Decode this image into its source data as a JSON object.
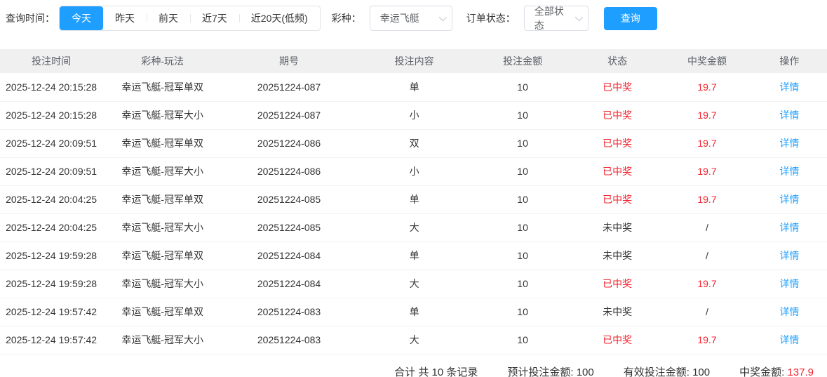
{
  "colors": {
    "accent": "#1e9fff",
    "win_red": "#f5222d"
  },
  "toolbar": {
    "time_label": "查询时间：",
    "time_options": [
      {
        "label": "今天",
        "active": true
      },
      {
        "label": "昨天",
        "active": false
      },
      {
        "label": "前天",
        "active": false
      },
      {
        "label": "近7天",
        "active": false
      },
      {
        "label": "近20天(低频)",
        "active": false
      }
    ],
    "lottery_label": "彩种：",
    "lottery_value": "幸运飞艇",
    "status_label": "订单状态：",
    "status_value": "全部状态",
    "query_button": "查询"
  },
  "table": {
    "headers": [
      "投注时间",
      "彩种-玩法",
      "期号",
      "投注内容",
      "投注金额",
      "状态",
      "中奖金额",
      "操作"
    ],
    "rows": [
      {
        "time": "2025-12-24 20:15:28",
        "game": "幸运飞艇-冠军单双",
        "issue": "20251224-087",
        "content": "单",
        "amount": "10",
        "status": "已中奖",
        "won": true,
        "prize": "19.7",
        "action": "详情"
      },
      {
        "time": "2025-12-24 20:15:28",
        "game": "幸运飞艇-冠军大小",
        "issue": "20251224-087",
        "content": "小",
        "amount": "10",
        "status": "已中奖",
        "won": true,
        "prize": "19.7",
        "action": "详情"
      },
      {
        "time": "2025-12-24 20:09:51",
        "game": "幸运飞艇-冠军单双",
        "issue": "20251224-086",
        "content": "双",
        "amount": "10",
        "status": "已中奖",
        "won": true,
        "prize": "19.7",
        "action": "详情"
      },
      {
        "time": "2025-12-24 20:09:51",
        "game": "幸运飞艇-冠军大小",
        "issue": "20251224-086",
        "content": "小",
        "amount": "10",
        "status": "已中奖",
        "won": true,
        "prize": "19.7",
        "action": "详情"
      },
      {
        "time": "2025-12-24 20:04:25",
        "game": "幸运飞艇-冠军单双",
        "issue": "20251224-085",
        "content": "单",
        "amount": "10",
        "status": "已中奖",
        "won": true,
        "prize": "19.7",
        "action": "详情"
      },
      {
        "time": "2025-12-24 20:04:25",
        "game": "幸运飞艇-冠军大小",
        "issue": "20251224-085",
        "content": "大",
        "amount": "10",
        "status": "未中奖",
        "won": false,
        "prize": "/",
        "action": "详情"
      },
      {
        "time": "2025-12-24 19:59:28",
        "game": "幸运飞艇-冠军单双",
        "issue": "20251224-084",
        "content": "单",
        "amount": "10",
        "status": "未中奖",
        "won": false,
        "prize": "/",
        "action": "详情"
      },
      {
        "time": "2025-12-24 19:59:28",
        "game": "幸运飞艇-冠军大小",
        "issue": "20251224-084",
        "content": "大",
        "amount": "10",
        "status": "已中奖",
        "won": true,
        "prize": "19.7",
        "action": "详情"
      },
      {
        "time": "2025-12-24 19:57:42",
        "game": "幸运飞艇-冠军单双",
        "issue": "20251224-083",
        "content": "单",
        "amount": "10",
        "status": "未中奖",
        "won": false,
        "prize": "/",
        "action": "详情"
      },
      {
        "time": "2025-12-24 19:57:42",
        "game": "幸运飞艇-冠军大小",
        "issue": "20251224-083",
        "content": "大",
        "amount": "10",
        "status": "已中奖",
        "won": true,
        "prize": "19.7",
        "action": "详情"
      }
    ]
  },
  "summary": {
    "total_text": "合计 共 10 条记录",
    "items": [
      {
        "label": "预计投注金额:",
        "value": "100",
        "highlight": false
      },
      {
        "label": "有效投注金额:",
        "value": "100",
        "highlight": false
      },
      {
        "label": "中奖金额:",
        "value": "137.9",
        "highlight": true
      }
    ]
  }
}
